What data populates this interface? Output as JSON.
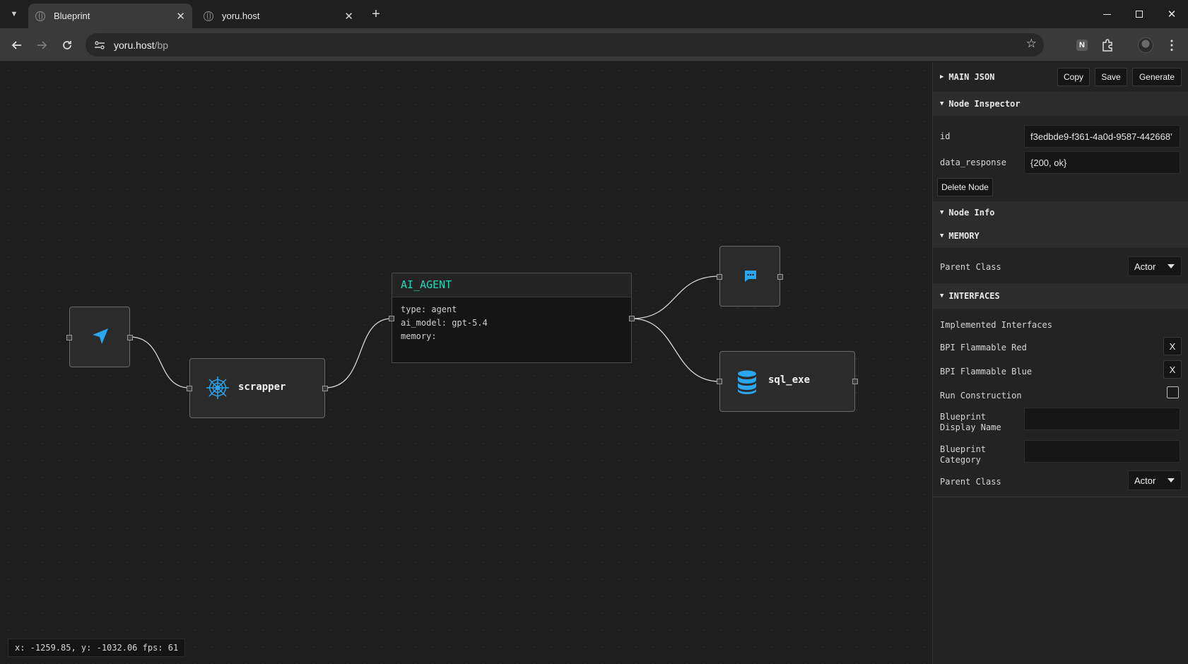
{
  "browser": {
    "tabs": [
      {
        "title": "Blueprint",
        "active": true
      },
      {
        "title": "yoru.host",
        "active": false
      }
    ],
    "tab_close_glyph": "✕",
    "new_tab_glyph": "+",
    "url_host": "yoru.host",
    "url_path": "/bp",
    "window_controls": {
      "minimize": "—",
      "maximize": "☐",
      "close": "✕"
    },
    "extension_badge": "N",
    "icons": [
      "tab-search-icon",
      "back-icon",
      "forward-icon",
      "reload-icon",
      "site-info-icon",
      "bookmark-star-icon",
      "extensions-icon",
      "profile-avatar",
      "menu-icon"
    ]
  },
  "canvas": {
    "nodes": {
      "location": {
        "icon": "navigation-arrow-icon",
        "color": "#2aa7f0"
      },
      "scrapper": {
        "label": "scrapper",
        "icon": "spider-web-icon",
        "color": "#2aa7f0"
      },
      "agent": {
        "title": "AI_AGENT",
        "title_color": "#27d6b4",
        "lines": [
          "type: agent",
          "ai_model: gpt-5.4",
          "memory:"
        ]
      },
      "chat": {
        "icon": "chat-bubble-icon",
        "color": "#2aa7f0"
      },
      "sql": {
        "label": "sql_exe",
        "icon": "database-icon",
        "color": "#2aa7f0"
      }
    },
    "status_text": "x: -1259.85, y: -1032.06 fps: 61"
  },
  "panel": {
    "main_json": {
      "title": "MAIN JSON",
      "buttons": {
        "copy": "Copy",
        "save": "Save",
        "generate": "Generate"
      }
    },
    "node_inspector": {
      "title": "Node Inspector",
      "id_label": "id",
      "id_value": "f3edbde9-f361-4a0d-9587-442668’",
      "data_response_label": "data_response",
      "data_response_value": "{200, ok}",
      "delete_button": "Delete Node"
    },
    "node_info": {
      "title": "Node Info"
    },
    "memory": {
      "title": "MEMORY",
      "parent_class_label": "Parent Class",
      "parent_class_value": "Actor"
    },
    "interfaces": {
      "title": "INTERFACES",
      "implemented_label": "Implemented Interfaces",
      "items": [
        "BPI Flammable Red",
        "BPI Flammable Blue"
      ],
      "remove_glyph": "X",
      "run_construction_label": "Run Construction",
      "display_name_label_1": "Blueprint",
      "display_name_label_2": "Display Name",
      "display_name_value": "",
      "category_label_1": "Blueprint",
      "category_label_2": "Category",
      "category_value": "",
      "parent_class_label": "Parent Class",
      "parent_class_value": "Actor"
    },
    "collapse_glyph_open": "▼",
    "collapse_glyph_closed": "▶"
  }
}
